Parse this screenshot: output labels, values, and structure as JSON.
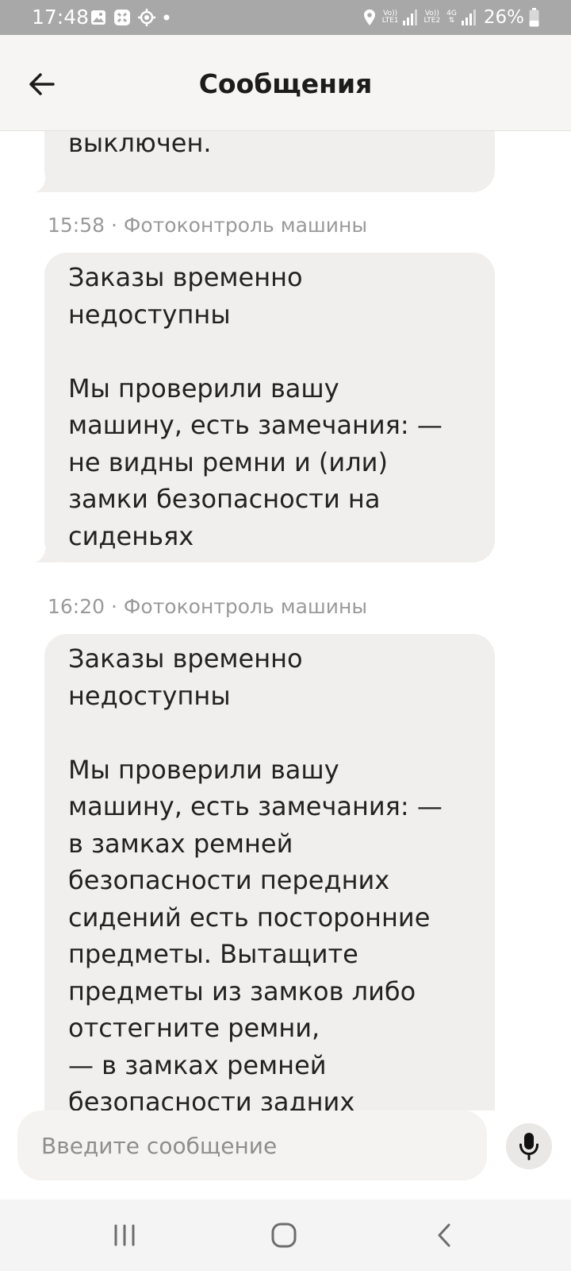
{
  "status_bar": {
    "time": "17:48",
    "network": {
      "sim1_top": "Vo))",
      "sim1_bottom": "LTE1",
      "sim2_top": "Vo))",
      "sim2_bottom": "LTE2",
      "data_type": "4G"
    },
    "battery": "26%",
    "icons": [
      "gallery-icon",
      "app-notification-icon",
      "location-target-icon",
      "dot-icon",
      "location-pin-icon",
      "signal-icon",
      "battery-icon"
    ]
  },
  "header": {
    "title": "Сообщения",
    "back_icon": "arrow-left-icon"
  },
  "messages": [
    {
      "text": "перемещения будет\nвыключен.",
      "partial": true
    },
    {
      "time": "15:58",
      "separator": "·",
      "sender": "Фотоконтроль машины",
      "text": "Заказы временно\nнедоступны\n\nМы проверили вашу\nмашину, есть замечания: —\nне видны ремни и (или)\nзамки безопасности на\nсиденьях"
    },
    {
      "time": "16:20",
      "separator": "·",
      "sender": "Фотоконтроль машины",
      "text": "Заказы временно\nнедоступны\n\nМы проверили вашу\nмашину, есть замечания: —\nв замках ремней\nбезопасности передних\nсидений есть посторонние\nпредметы. Вытащите\nпредметы из замков либо\nотстегните ремни,\n— в замках ремней\nбезопасности задних",
      "partial": true
    }
  ],
  "composer": {
    "placeholder": "Введите сообщение",
    "value": "",
    "mic_icon": "microphone-icon"
  },
  "colors": {
    "status_bar": "#a8a8a8",
    "app_bar": "#f6f5f3",
    "bubble": "#f0efed",
    "meta_text": "#9a9a9a",
    "input_bg": "#f4f3f1"
  }
}
